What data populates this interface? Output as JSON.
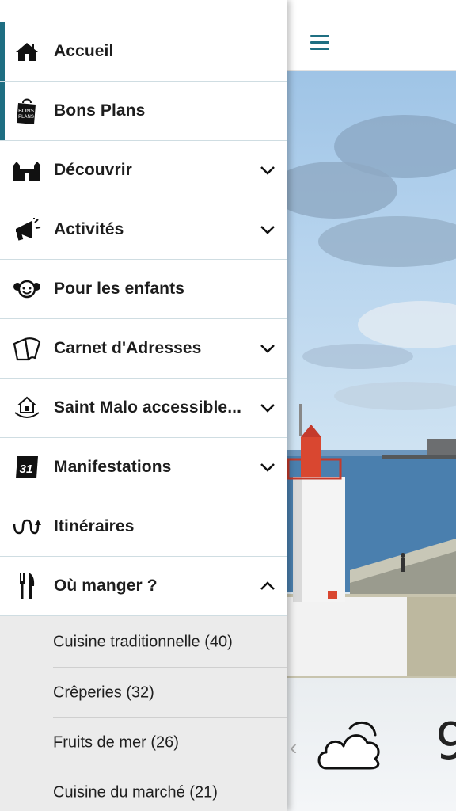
{
  "menu": {
    "items": [
      {
        "label": "Accueil",
        "icon": "home-icon",
        "active": true
      },
      {
        "label": "Bons Plans",
        "icon": "bons-plans-bag-icon",
        "active": true,
        "icon_text": "BONS PLANS"
      },
      {
        "label": "Découvrir",
        "icon": "castle-icon",
        "expandable": true
      },
      {
        "label": "Activités",
        "icon": "megaphone-icon",
        "expandable": true
      },
      {
        "label": "Pour les enfants",
        "icon": "child-face-icon"
      },
      {
        "label": "Carnet d'Adresses",
        "icon": "open-book-icon",
        "expandable": true
      },
      {
        "label": "Saint Malo accessible...",
        "icon": "accessible-house-icon",
        "expandable": true
      },
      {
        "label": "Manifestations",
        "icon": "calendar-icon",
        "expandable": true,
        "icon_text": "31"
      },
      {
        "label": "Itinéraires",
        "icon": "route-icon"
      },
      {
        "label": "Où manger ?",
        "icon": "fork-knife-icon",
        "expandable": true,
        "expanded": true
      }
    ],
    "submenu": [
      "Cuisine traditionnelle (40)",
      "Crêperies (32)",
      "Fruits de mer (26)",
      "Cuisine du marché (21)"
    ]
  },
  "header": {
    "menu_icon": "hamburger-menu-icon"
  },
  "weather": {
    "icon": "cloud-icon",
    "temperature_partial": "9"
  },
  "colors": {
    "accent": "#1e6e82",
    "divider": "#cfdde2",
    "submenu_bg": "#ebebeb"
  }
}
